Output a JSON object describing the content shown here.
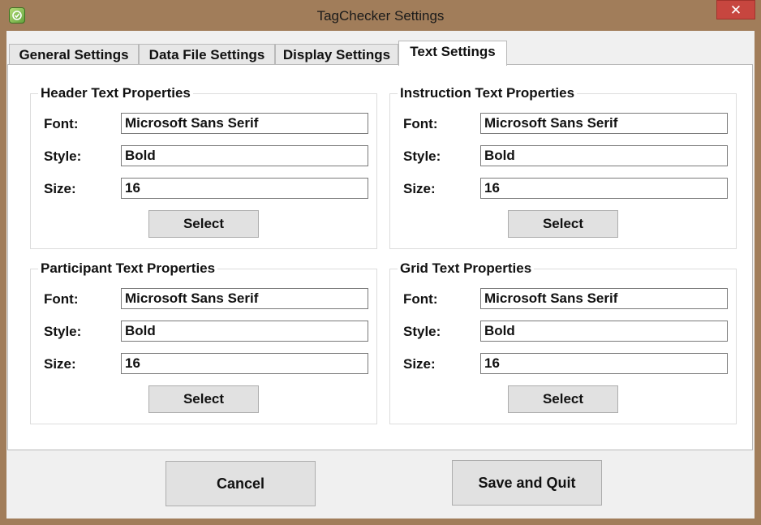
{
  "window": {
    "title": "TagChecker Settings",
    "close_glyph": "✕"
  },
  "tabs": [
    {
      "label": "General Settings",
      "active": false
    },
    {
      "label": "Data File Settings",
      "active": false
    },
    {
      "label": "Display Settings",
      "active": false
    },
    {
      "label": "Text Settings",
      "active": true
    }
  ],
  "groups": {
    "header": {
      "title": "Header Text Properties",
      "font_label": "Font:",
      "font_value": "Microsoft Sans Serif",
      "style_label": "Style:",
      "style_value": "Bold",
      "size_label": "Size:",
      "size_value": "16",
      "select_label": "Select"
    },
    "instruction": {
      "title": "Instruction Text Properties",
      "font_label": "Font:",
      "font_value": "Microsoft Sans Serif",
      "style_label": "Style:",
      "style_value": "Bold",
      "size_label": "Size:",
      "size_value": "16",
      "select_label": "Select"
    },
    "participant": {
      "title": "Participant Text Properties",
      "font_label": "Font:",
      "font_value": "Microsoft Sans Serif",
      "style_label": "Style:",
      "style_value": "Bold",
      "size_label": "Size:",
      "size_value": "16",
      "select_label": "Select"
    },
    "grid": {
      "title": "Grid Text Properties",
      "font_label": "Font:",
      "font_value": "Microsoft Sans Serif",
      "style_label": "Style:",
      "style_value": "Bold",
      "size_label": "Size:",
      "size_value": "16",
      "select_label": "Select"
    }
  },
  "footer": {
    "cancel_label": "Cancel",
    "save_label": "Save and Quit"
  },
  "colors": {
    "frame": "#a17d5a",
    "close": "#c7463f",
    "client": "#f0f0f0"
  }
}
